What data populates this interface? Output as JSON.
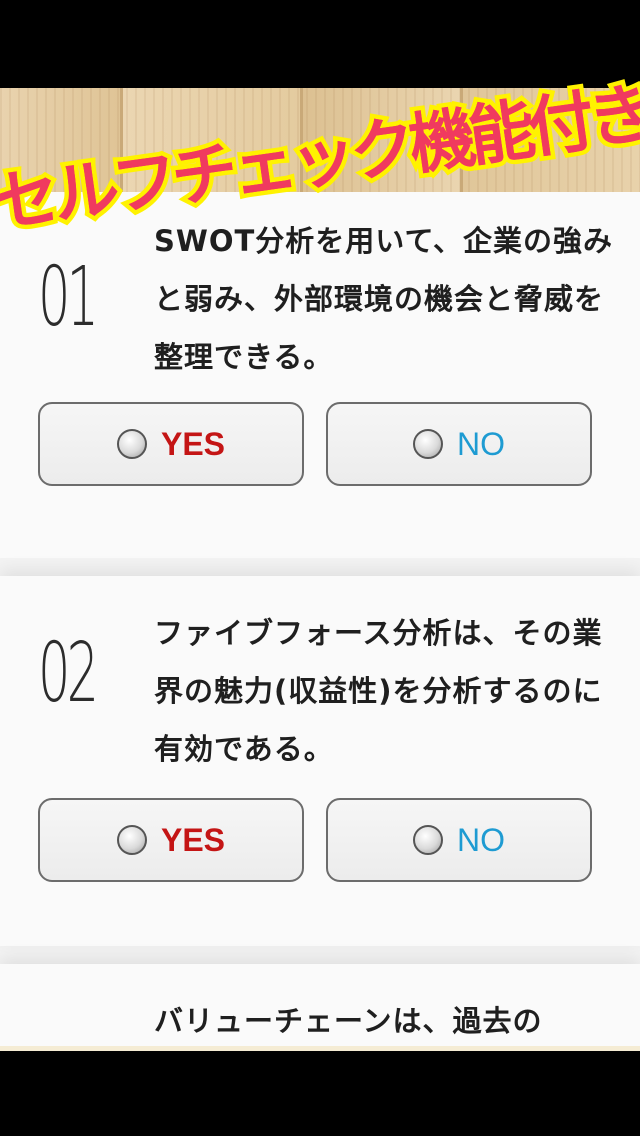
{
  "banner": {
    "text": "セルフチェック機能付き!!"
  },
  "questions": [
    {
      "number": "01",
      "text": "SWOT分析を用いて、企業の強みと弱み、外部環境の機会と脅威を整理できる。",
      "yes_label": "YES",
      "no_label": "NO"
    },
    {
      "number": "02",
      "text": "ファイブフォース分析は、その業界の魅力(収益性)を分析するのに有効である。",
      "yes_label": "YES",
      "no_label": "NO"
    },
    {
      "text": "バリューチェーンは、過去の"
    }
  ],
  "colors": {
    "yes": "#c41515",
    "no": "#1e9bd2",
    "banner_text": "#f03a5f",
    "banner_outline": "#fff200"
  },
  "icons": {
    "radio": "radio-button-icon"
  }
}
